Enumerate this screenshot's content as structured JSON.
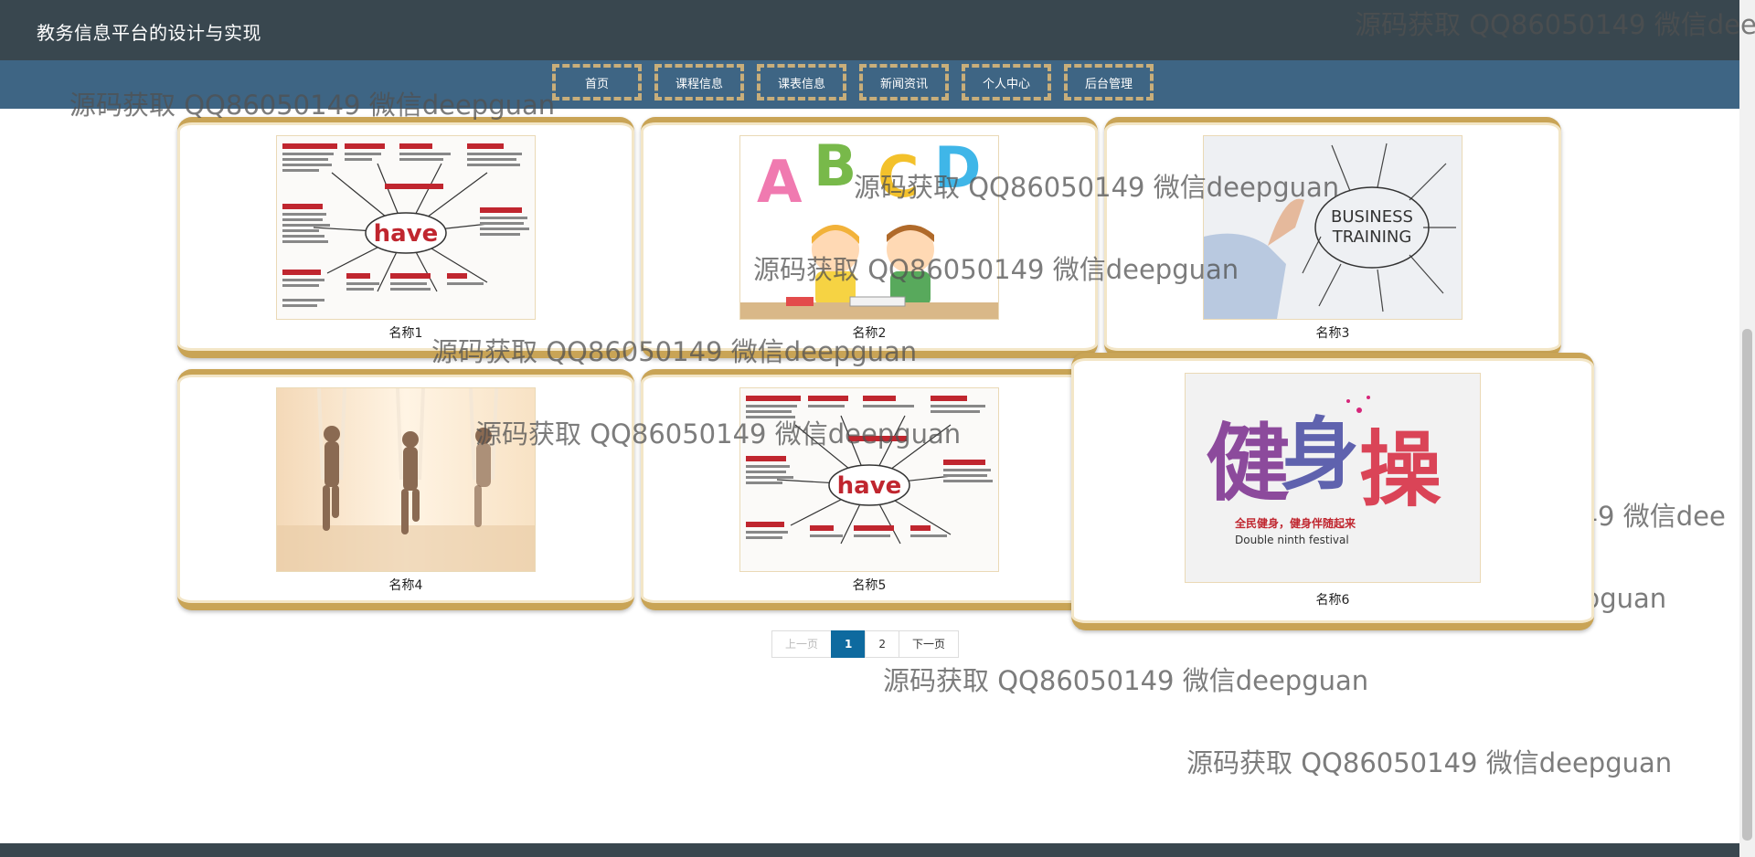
{
  "header": {
    "title": "教务信息平台的设计与实现"
  },
  "nav": [
    "首页",
    "课程信息",
    "课表信息",
    "新闻资讯",
    "个人中心",
    "后台管理"
  ],
  "cards": [
    {
      "name": "名称1",
      "image": "have-mindmap"
    },
    {
      "name": "名称2",
      "image": "abcd-children-studying"
    },
    {
      "name": "名称3",
      "image": "business-training"
    },
    {
      "name": "名称4",
      "image": "aerial-yoga"
    },
    {
      "name": "名称5",
      "image": "have-mindmap"
    },
    {
      "name": "名称6",
      "image": "jianshencao-poster"
    }
  ],
  "image_text": {
    "have": "have",
    "business": "BUSINESS",
    "training": "TRAINING",
    "poster_sub": "全民健身，健身伴随起来",
    "poster_en": "Double ninth festival"
  },
  "pagination": {
    "prev": "上一页",
    "pages": [
      "1",
      "2"
    ],
    "current": "1",
    "next": "下一页"
  },
  "watermark": "源码获取 QQ86050149 微信deepguan"
}
